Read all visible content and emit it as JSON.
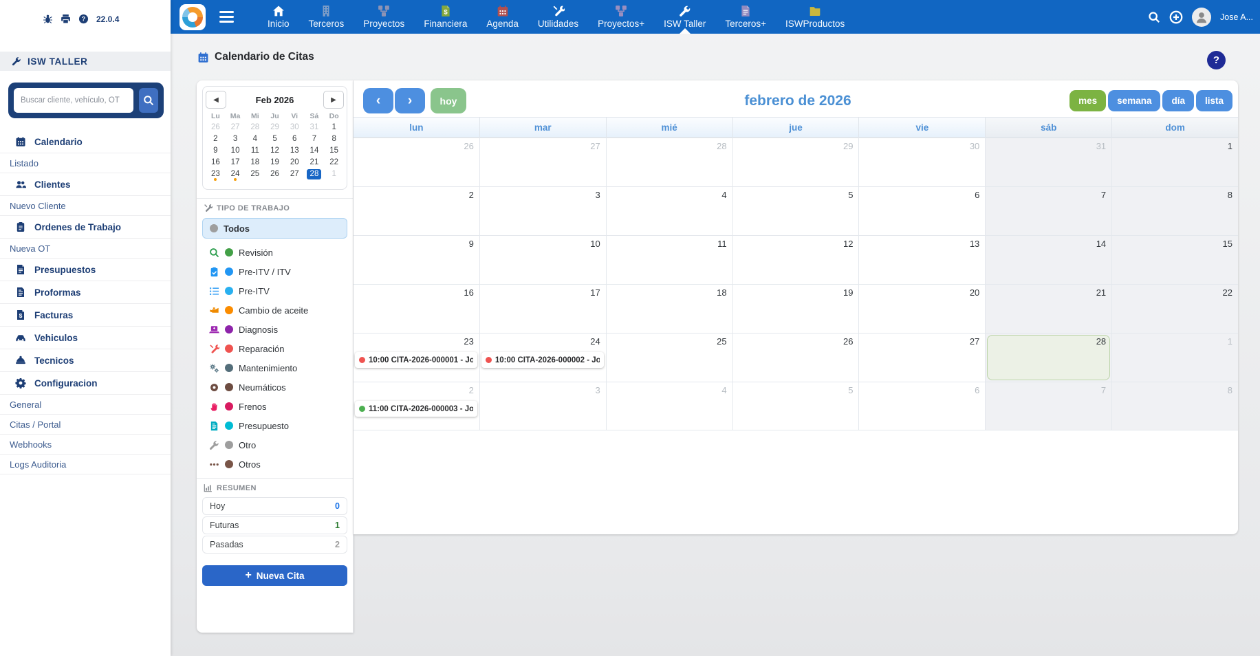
{
  "colors": {
    "navbar_bg": "#1166c2",
    "navy": "#1d3e75",
    "accent_blue": "#4d8fe0",
    "title_blue": "#4b90d4",
    "green_active": "#7cb342",
    "hoy_green": "#8ac58c",
    "today_bg": "#ecf1e6",
    "today_border": "#bcd4a9",
    "event_red": "#ef5350",
    "event_green": "#4caf50",
    "minical_selected": "#1766c5",
    "minical_dot": "#f59e0b"
  },
  "navbar": {
    "items": [
      {
        "label": "Inicio",
        "icon": "home-icon",
        "icon_color": "#ffffff"
      },
      {
        "label": "Terceros",
        "icon": "building-icon",
        "icon_color": "#7f9ec7"
      },
      {
        "label": "Proyectos",
        "icon": "diagram-icon",
        "icon_color": "#8d93b5"
      },
      {
        "label": "Financiera",
        "icon": "invoice-icon",
        "icon_color": "#85a83e"
      },
      {
        "label": "Agenda",
        "icon": "calendar-icon",
        "icon_color": "#b05050"
      },
      {
        "label": "Utilidades",
        "icon": "tools-icon",
        "icon_color": "#ffffff"
      },
      {
        "label": "Proyectos+",
        "icon": "diagram-icon",
        "icon_color": "#9a8fc0"
      },
      {
        "label": "ISW Taller",
        "icon": "wrench-icon",
        "icon_color": "#ffffff",
        "active": true
      },
      {
        "label": "Terceros+",
        "icon": "doc-icon",
        "icon_color": "#938bc0"
      },
      {
        "label": "ISWProductos",
        "icon": "folder-icon",
        "icon_color": "#c9b73e"
      }
    ],
    "user": "Jose A..."
  },
  "sidebar": {
    "version": "22.0.4",
    "app_title": "ISW TALLER",
    "search_placeholder": "Buscar cliente, vehículo, OT",
    "menu": [
      {
        "label": "Calendario",
        "icon": "calendar-icon",
        "type": "main"
      },
      {
        "label": "Listado",
        "type": "sub"
      },
      {
        "label": "Clientes",
        "icon": "users-icon",
        "type": "main"
      },
      {
        "label": "Nuevo Cliente",
        "type": "sub"
      },
      {
        "label": "Ordenes de Trabajo",
        "icon": "clipboard-icon",
        "type": "main"
      },
      {
        "label": "Nueva OT",
        "type": "sub"
      },
      {
        "label": "Presupuestos",
        "icon": "doc-icon",
        "type": "main"
      },
      {
        "label": "Proformas",
        "icon": "doc-lines-icon",
        "type": "main"
      },
      {
        "label": "Facturas",
        "icon": "invoice-icon",
        "type": "main"
      },
      {
        "label": "Vehiculos",
        "icon": "car-icon",
        "type": "main"
      },
      {
        "label": "Tecnicos",
        "icon": "helmet-icon",
        "type": "main"
      },
      {
        "label": "Configuracion",
        "icon": "gear-icon",
        "type": "main"
      },
      {
        "label": "General",
        "type": "sub"
      },
      {
        "label": "Citas / Portal",
        "type": "sub"
      },
      {
        "label": "Webhooks",
        "type": "sub"
      },
      {
        "label": "Logs Auditoria",
        "type": "sub"
      }
    ]
  },
  "page": {
    "title": "Calendario de Citas",
    "help_label": "?"
  },
  "mini_calendar": {
    "month_label": "Feb 2026",
    "weekdays": [
      "Lu",
      "Ma",
      "Mi",
      "Ju",
      "Vi",
      "Sá",
      "Do"
    ],
    "weeks": [
      [
        {
          "n": 26,
          "m": 1
        },
        {
          "n": 27,
          "m": 1
        },
        {
          "n": 28,
          "m": 1
        },
        {
          "n": 29,
          "m": 1
        },
        {
          "n": 30,
          "m": 1
        },
        {
          "n": 31,
          "m": 1
        },
        {
          "n": 1
        }
      ],
      [
        {
          "n": 2
        },
        {
          "n": 3
        },
        {
          "n": 4
        },
        {
          "n": 5
        },
        {
          "n": 6
        },
        {
          "n": 7
        },
        {
          "n": 8
        }
      ],
      [
        {
          "n": 9
        },
        {
          "n": 10
        },
        {
          "n": 11
        },
        {
          "n": 12
        },
        {
          "n": 13
        },
        {
          "n": 14
        },
        {
          "n": 15
        }
      ],
      [
        {
          "n": 16
        },
        {
          "n": 17
        },
        {
          "n": 18
        },
        {
          "n": 19
        },
        {
          "n": 20
        },
        {
          "n": 21
        },
        {
          "n": 22
        }
      ],
      [
        {
          "n": 23,
          "dot": 1
        },
        {
          "n": 24,
          "dot": 1
        },
        {
          "n": 25
        },
        {
          "n": 26
        },
        {
          "n": 27
        },
        {
          "n": 28,
          "sel": 1
        },
        {
          "n": 1,
          "m": 1
        }
      ]
    ]
  },
  "filters": {
    "section_title": "TIPO DE TRABAJO",
    "items": [
      {
        "label": "Todos",
        "dot": "#9e9e9e",
        "selected": true
      },
      {
        "label": "Revisión",
        "icon": "search-icon",
        "icon_color": "#2e9e4f",
        "dot": "#43a047"
      },
      {
        "label": "Pre-ITV / ITV",
        "icon": "clipboard-check-icon",
        "icon_color": "#2196f3",
        "dot": "#2196f3"
      },
      {
        "label": "Pre-ITV",
        "icon": "list-icon",
        "icon_color": "#42a5f5",
        "dot": "#29b0f0"
      },
      {
        "label": "Cambio de aceite",
        "icon": "oilcan-icon",
        "icon_color": "#ef8a00",
        "dot": "#fb8c00"
      },
      {
        "label": "Diagnosis",
        "icon": "laptop-icon",
        "icon_color": "#9c27b0",
        "dot": "#8e24aa"
      },
      {
        "label": "Reparación",
        "icon": "tools-icon",
        "icon_color": "#ef5350",
        "dot": "#ef5350"
      },
      {
        "label": "Mantenimiento",
        "icon": "gears-icon",
        "icon_color": "#607d8b",
        "dot": "#546e7a"
      },
      {
        "label": "Neumáticos",
        "icon": "circle-icon",
        "icon_color": "#6d4c41",
        "dot": "#6d4c41"
      },
      {
        "label": "Frenos",
        "icon": "hand-icon",
        "icon_color": "#e91e63",
        "dot": "#d81b60"
      },
      {
        "label": "Presupuesto",
        "icon": "doc-lines-icon",
        "icon_color": "#00acc1",
        "dot": "#00bcd4"
      },
      {
        "label": "Otro",
        "icon": "wrench-icon",
        "icon_color": "#9e9e9e",
        "dot": "#9e9e9e"
      },
      {
        "label": "Otros",
        "icon": "ellipsis-icon",
        "icon_color": "#795548",
        "dot": "#795548"
      }
    ]
  },
  "summary": {
    "section_title": "RESUMEN",
    "rows": [
      {
        "label": "Hoy",
        "count": "0",
        "color": "#1a73e8"
      },
      {
        "label": "Futuras",
        "count": "1",
        "color": "#2e7d32"
      },
      {
        "label": "Pasadas",
        "count": "2",
        "color": "#9e9e9e"
      }
    ],
    "new_button": "Nueva Cita"
  },
  "calendar": {
    "title": "febrero de 2026",
    "toolbar": {
      "today_label": "hoy"
    },
    "views": [
      {
        "label": "mes",
        "active": true
      },
      {
        "label": "semana"
      },
      {
        "label": "día"
      },
      {
        "label": "lista"
      }
    ],
    "weekday_headers": [
      "lun",
      "mar",
      "mié",
      "jue",
      "vie",
      "sáb",
      "dom"
    ],
    "weeks": [
      [
        {
          "n": 26,
          "o": 1
        },
        {
          "n": 27,
          "o": 1
        },
        {
          "n": 28,
          "o": 1
        },
        {
          "n": 29,
          "o": 1
        },
        {
          "n": 30,
          "o": 1
        },
        {
          "n": 31,
          "o": 1
        },
        {
          "n": 1
        }
      ],
      [
        {
          "n": 2
        },
        {
          "n": 3
        },
        {
          "n": 4
        },
        {
          "n": 5
        },
        {
          "n": 6
        },
        {
          "n": 7
        },
        {
          "n": 8
        }
      ],
      [
        {
          "n": 9
        },
        {
          "n": 10
        },
        {
          "n": 11
        },
        {
          "n": 12
        },
        {
          "n": 13
        },
        {
          "n": 14
        },
        {
          "n": 15
        }
      ],
      [
        {
          "n": 16
        },
        {
          "n": 17
        },
        {
          "n": 18
        },
        {
          "n": 19
        },
        {
          "n": 20
        },
        {
          "n": 21
        },
        {
          "n": 22
        }
      ],
      [
        {
          "n": 23
        },
        {
          "n": 24
        },
        {
          "n": 25
        },
        {
          "n": 26
        },
        {
          "n": 27
        },
        {
          "n": 28,
          "today": 1
        },
        {
          "n": 1,
          "o": 1
        }
      ],
      [
        {
          "n": 2,
          "o": 1
        },
        {
          "n": 3,
          "o": 1
        },
        {
          "n": 4,
          "o": 1
        },
        {
          "n": 5,
          "o": 1
        },
        {
          "n": 6,
          "o": 1
        },
        {
          "n": 7,
          "o": 1
        },
        {
          "n": 8,
          "o": 1
        }
      ]
    ],
    "events": [
      {
        "week": 4,
        "col": 0,
        "time": "10:00",
        "title": "CITA-2026-000001 - Jo",
        "dot": "#ef5350"
      },
      {
        "week": 4,
        "col": 1,
        "time": "10:00",
        "title": "CITA-2026-000002 - Jo",
        "dot": "#ef5350"
      },
      {
        "week": 5,
        "col": 0,
        "time": "11:00",
        "title": "CITA-2026-000003 - Jo",
        "dot": "#4caf50"
      }
    ]
  }
}
